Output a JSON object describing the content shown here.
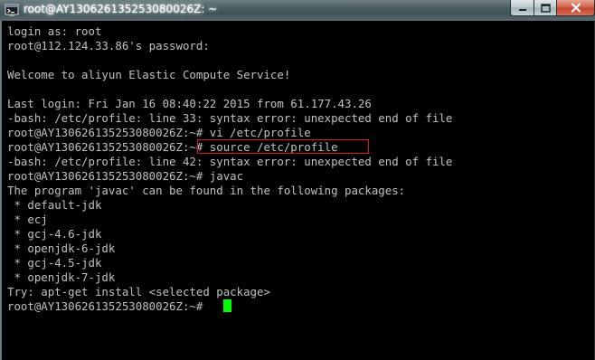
{
  "window": {
    "title": "root@AY13062613525308002​6Z: ~"
  },
  "controls": {
    "minimize_icon": "minimize-icon",
    "maximize_icon": "maximize-icon",
    "close_icon": "close-icon"
  },
  "terminal": {
    "lines": [
      "login as: root",
      "root@112.124.33.86's password:",
      "",
      "Welcome to aliyun Elastic Compute Service!",
      "",
      "Last login: Fri Jan 16 08:40:22 2015 from 61.177.43.26",
      "-bash: /etc/profile: line 33: syntax error: unexpected end of file",
      "root@AY130626135253080026Z:~# vi /etc/profile",
      "root@AY130626135253080026Z:~# source /etc/profile",
      "-bash: /etc/profile: line 42: syntax error: unexpected end of file",
      "root@AY130626135253080026Z:~# javac",
      "The program 'javac' can be found in the following packages:",
      " * default-jdk",
      " * ecj",
      " * gcj-4.6-jdk",
      " * openjdk-6-jdk",
      " * gcj-4.5-jdk",
      " * openjdk-7-jdk",
      "Try: apt-get install <selected package>",
      "root@AY130626135253080026Z:~# "
    ],
    "cursor_color": "#00ff00",
    "highlight_color": "#d21c1c"
  }
}
